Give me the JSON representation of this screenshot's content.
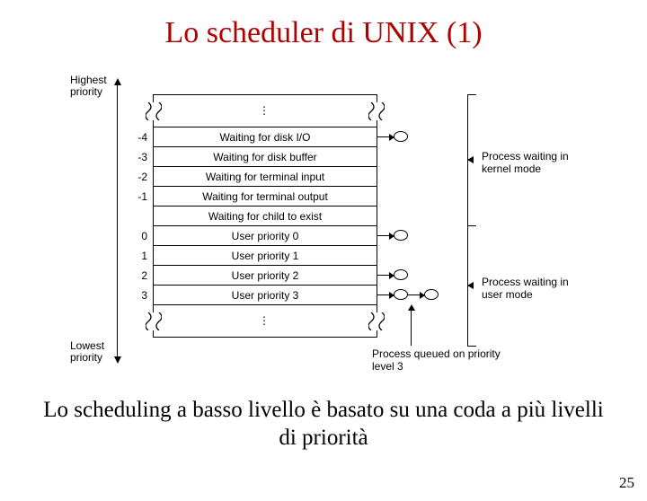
{
  "title": "Lo scheduler di UNIX (1)",
  "caption": "Lo scheduling a basso livello è basato su una coda a più livelli di priorità",
  "page_number": "25",
  "diagram": {
    "highest_label": "Highest\npriority",
    "lowest_label": "Lowest\npriority",
    "kernel_mode_label": "Process waiting in kernel mode",
    "user_mode_label": "Process waiting in user mode",
    "queue_label": "Process queued on priority level 3",
    "rows": [
      {
        "priority": "-4",
        "text": "Waiting for disk I/O",
        "nodes": 1
      },
      {
        "priority": "-3",
        "text": "Waiting for disk buffer",
        "nodes": 0
      },
      {
        "priority": "-2",
        "text": "Waiting for terminal input",
        "nodes": 0
      },
      {
        "priority": "-1",
        "text": "Waiting for terminal output",
        "nodes": 0
      },
      {
        "priority": "",
        "text": "Waiting for child to exist",
        "nodes": 0
      },
      {
        "priority": "0",
        "text": "User priority 0",
        "nodes": 1
      },
      {
        "priority": "1",
        "text": "User priority 1",
        "nodes": 0
      },
      {
        "priority": "2",
        "text": "User priority 2",
        "nodes": 1
      },
      {
        "priority": "3",
        "text": "User priority 3",
        "nodes": 2
      }
    ]
  }
}
